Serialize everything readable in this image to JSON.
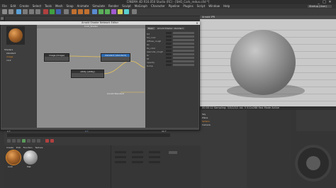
{
  "app": {
    "title": "CINEMA 4D R16.050 Studio (RC) - [SHO_Cork_redux.c4d *]",
    "layout": "Startup (User)",
    "window_controls": [
      "_",
      "□",
      "✕"
    ]
  },
  "menu": [
    "File",
    "Edit",
    "Create",
    "Select",
    "Tools",
    "Mesh",
    "Snap",
    "Animate",
    "Simulate",
    "Render",
    "Sculpt",
    "MoGraph",
    "Character",
    "Pipeline",
    "Plugins",
    "Script",
    "Window",
    "Help"
  ],
  "colors": {
    "accent": "#2f6db5",
    "viewport_bg": "#c9c9c9",
    "node_canvas": "#8f8f8f",
    "selection_orange": "#e08a2c"
  },
  "node_editor": {
    "title": "Arnold Shader Network Editor",
    "canvas_header": "Cork_Shader",
    "tree_items": [
      "Shaders",
      "standard",
      "image",
      "cork"
    ],
    "nodes": [
      {
        "label": "image (image)",
        "selected": false
      },
      {
        "label": "standard (standard)",
        "selected": true
      },
      {
        "label": "utility (utility)",
        "selected": false
      }
    ],
    "status": "Arnold Standard",
    "props": {
      "tabs": [
        "Basic",
        "Arnold Shader: standard"
      ],
      "rows": [
        "Kd",
        "Kd_color",
        "diffuse_rough",
        "Ks",
        "Ks_color",
        "specular_rough",
        "Kr",
        "Kt",
        "opacity",
        "bump"
      ]
    }
  },
  "viewport": {
    "header": "Arnold IPR",
    "status": "00:00:12  Sampling: 3/3/2/2/2  AA: 3  512x288  Fast Mode  Active"
  },
  "timeline": {
    "start": "0 F",
    "end": "90 F",
    "current": "0 F"
  },
  "material_manager": {
    "menu": [
      "Create",
      "Edit",
      "Function",
      "Texture"
    ],
    "materials": [
      {
        "name": "Cork",
        "selected": true
      },
      {
        "name": "Mat",
        "selected": false
      }
    ]
  },
  "object_manager": {
    "items": [
      "Sky",
      "Plane",
      "Sphere",
      "Camera"
    ]
  }
}
